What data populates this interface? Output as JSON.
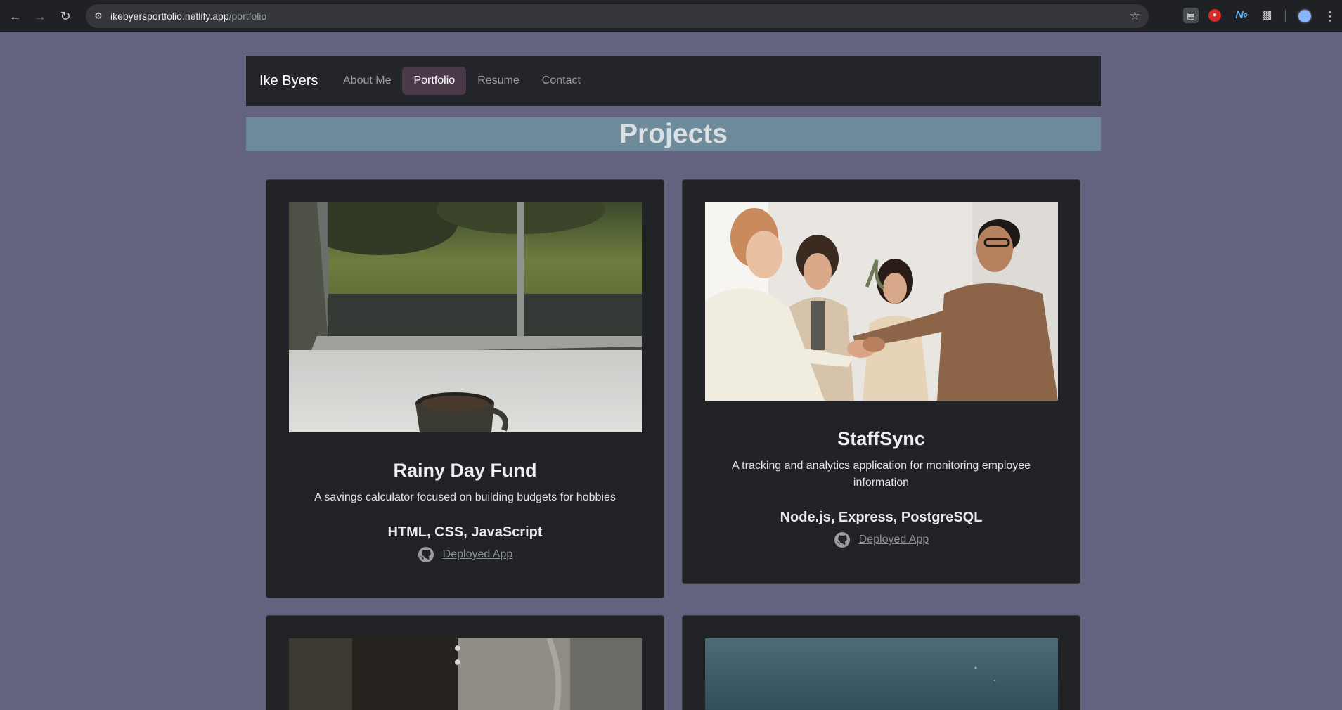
{
  "browser": {
    "url_host": "ikebyersportfolio.netlify.app",
    "url_path": "/portfolio"
  },
  "site": {
    "brand": "Ike Byers",
    "nav": [
      {
        "label": "About Me",
        "active": false
      },
      {
        "label": "Portfolio",
        "active": true
      },
      {
        "label": "Resume",
        "active": false
      },
      {
        "label": "Contact",
        "active": false
      }
    ]
  },
  "page": {
    "heading": "Projects"
  },
  "projects": [
    {
      "title": "Rainy Day Fund",
      "description": "A savings calculator focused on building budgets for hobbies",
      "tech": "HTML, CSS, JavaScript",
      "link_label": "Deployed App",
      "image": "rainy-window-coffee-photo"
    },
    {
      "title": "StaffSync",
      "description": "A tracking and analytics application for monitoring employee information",
      "tech": "Node.js, Express, PostgreSQL",
      "link_label": "Deployed App",
      "image": "team-handshake-photo"
    },
    {
      "image": "suit-jacket-photo"
    },
    {
      "image": "ocean-water-photo"
    }
  ]
}
